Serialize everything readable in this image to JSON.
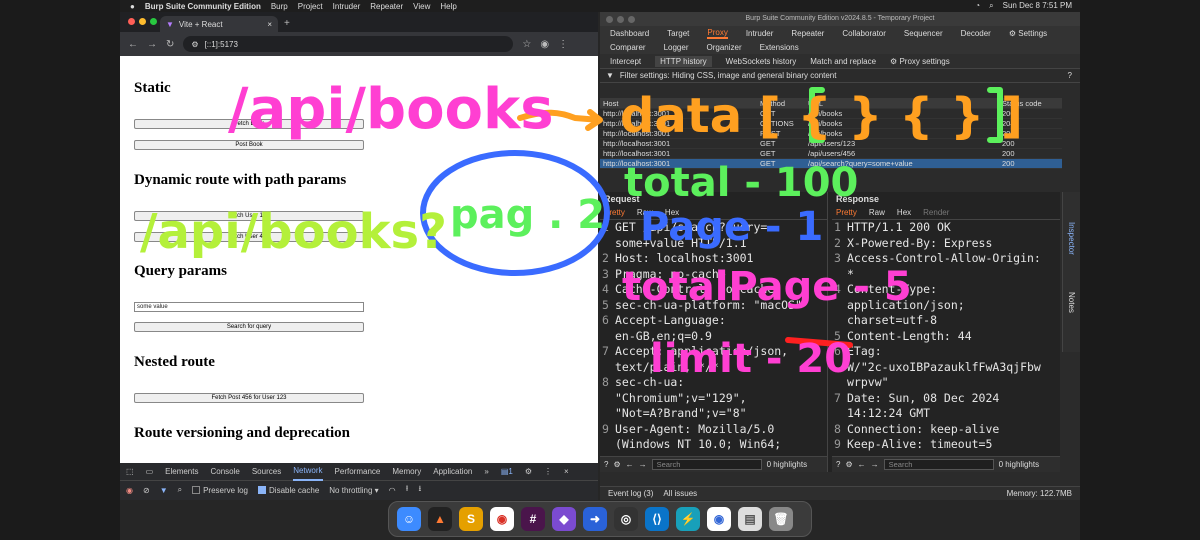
{
  "menubar": {
    "app": "Burp Suite Community Edition",
    "items": [
      "Burp",
      "Project",
      "Intruder",
      "Repeater",
      "View",
      "Help"
    ],
    "clock": "Sun Dec 8  7:51 PM"
  },
  "browser": {
    "tab_title": "Vite + React",
    "url": "[::1]:5173"
  },
  "page": {
    "h_static": "Static",
    "btn_fetch_book": "Fetch Book",
    "btn_post_book": "Post Book",
    "h_dynamic": "Dynamic route with path params",
    "btn_user_123": "Fetch User 123",
    "btn_user_456": "Fetch User 456",
    "h_query": "Query params",
    "query_input_value": "some value",
    "btn_search": "Search for query",
    "h_nested": "Nested route",
    "btn_nested": "Fetch Post 456 for User 123",
    "h_versioning": "Route versioning and deprecation"
  },
  "devtools": {
    "tabs": [
      "Elements",
      "Console",
      "Sources",
      "Network",
      "Performance",
      "Memory",
      "Application"
    ],
    "active_tab": "Network",
    "preserve_log": "Preserve log",
    "disable_cache": "Disable cache",
    "throttle": "No throttling",
    "badge": "1"
  },
  "burp": {
    "title": "Burp Suite Community Edition v2024.8.5 - Temporary Project",
    "nav1": [
      "Dashboard",
      "Target",
      "Proxy",
      "Intruder",
      "Repeater",
      "Collaborator",
      "Sequencer",
      "Decoder",
      "Settings"
    ],
    "nav1_active": "Proxy",
    "nav2": [
      "Comparer",
      "Logger",
      "Organizer",
      "Extensions"
    ],
    "subtabs": [
      "Intercept",
      "HTTP history",
      "WebSockets history",
      "Match and replace",
      "Proxy settings"
    ],
    "subtab_active": "HTTP history",
    "filter": "Filter settings: Hiding CSS, image and general binary content",
    "table_headers": [
      "Host",
      "Method",
      "URL",
      "Status code"
    ],
    "rows": [
      [
        "http://localhost:3001",
        "GET",
        "/api/books",
        "200"
      ],
      [
        "http://localhost:3001",
        "OPTIONS",
        "/api/books",
        "204"
      ],
      [
        "http://localhost:3001",
        "POST",
        "/api/books",
        "200"
      ],
      [
        "http://localhost:3001",
        "GET",
        "/api/users/123",
        "200"
      ],
      [
        "http://localhost:3001",
        "GET",
        "/api/users/456",
        "200"
      ],
      [
        "http://localhost:3001",
        "GET",
        "/api/search?query=some+value",
        "200"
      ]
    ],
    "request_title": "Request",
    "response_title": "Response",
    "req_tabs": [
      "Pretty",
      "Raw",
      "Hex"
    ],
    "resp_tabs": [
      "Pretty",
      "Raw",
      "Hex",
      "Render"
    ],
    "request_lines": [
      {
        "n": "1",
        "t": "GET /api/search?query="
      },
      {
        "n": "",
        "t": "some+value HTTP/1.1"
      },
      {
        "n": "2",
        "t": "Host: localhost:3001"
      },
      {
        "n": "3",
        "t": "Pragma: no-cache"
      },
      {
        "n": "4",
        "t": "Cache-Control: no-cache"
      },
      {
        "n": "5",
        "t": "sec-ch-ua-platform: \"macOS\""
      },
      {
        "n": "6",
        "t": "Accept-Language:"
      },
      {
        "n": "",
        "t": "en-GB,en;q=0.9"
      },
      {
        "n": "7",
        "t": "Accept: application/json,"
      },
      {
        "n": "",
        "t": "text/plain, */*"
      },
      {
        "n": "8",
        "t": "sec-ch-ua:"
      },
      {
        "n": "",
        "t": "\"Chromium\";v=\"129\","
      },
      {
        "n": "",
        "t": "\"Not=A?Brand\";v=\"8\""
      },
      {
        "n": "9",
        "t": "User-Agent: Mozilla/5.0"
      },
      {
        "n": "",
        "t": "(Windows NT 10.0; Win64;"
      }
    ],
    "response_lines": [
      {
        "n": "1",
        "t": "HTTP/1.1 200 OK"
      },
      {
        "n": "2",
        "t": "X-Powered-By: Express"
      },
      {
        "n": "3",
        "t": "Access-Control-Allow-Origin:"
      },
      {
        "n": "",
        "t": "*"
      },
      {
        "n": "4",
        "t": "Content-Type:"
      },
      {
        "n": "",
        "t": "application/json;"
      },
      {
        "n": "",
        "t": "charset=utf-8"
      },
      {
        "n": "5",
        "t": "Content-Length: 44"
      },
      {
        "n": "6",
        "t": "ETag:"
      },
      {
        "n": "",
        "t": "W/\"2c-uxoIBPazauklfFwA3qjFbw"
      },
      {
        "n": "",
        "t": "wrpvw\""
      },
      {
        "n": "7",
        "t": "Date: Sun, 08 Dec 2024"
      },
      {
        "n": "",
        "t": "14:12:24 GMT"
      },
      {
        "n": "8",
        "t": "Connection: keep-alive"
      },
      {
        "n": "9",
        "t": "Keep-Alive: timeout=5"
      }
    ],
    "search_placeholder": "Search",
    "highlights": "0 highlights",
    "inspector": "Inspector",
    "notes": "Notes",
    "event_log": "Event log (3)",
    "all_issues": "All issues",
    "memory": "Memory: 122.7MB"
  },
  "annotations": {
    "api_books": "/api/books",
    "data_array": "data [ { } { } ]",
    "api_books_2": "/api/books?",
    "page_2": "pag . 2",
    "total": "total - 100",
    "page": "Page - 1",
    "total_page": "totalPage - 5",
    "limit": "limit - 20"
  },
  "colors": {
    "burp_orange": "#ff7a33",
    "selected_row": "#2f5f94",
    "ink_pink": "#ff3fd2",
    "ink_orange": "#ffa020",
    "ink_green": "#5cf05c",
    "ink_blue": "#3a6bff",
    "ink_yellow": "#ffe020",
    "ink_red": "#ff2020",
    "ink_lime": "#b4f03a"
  }
}
